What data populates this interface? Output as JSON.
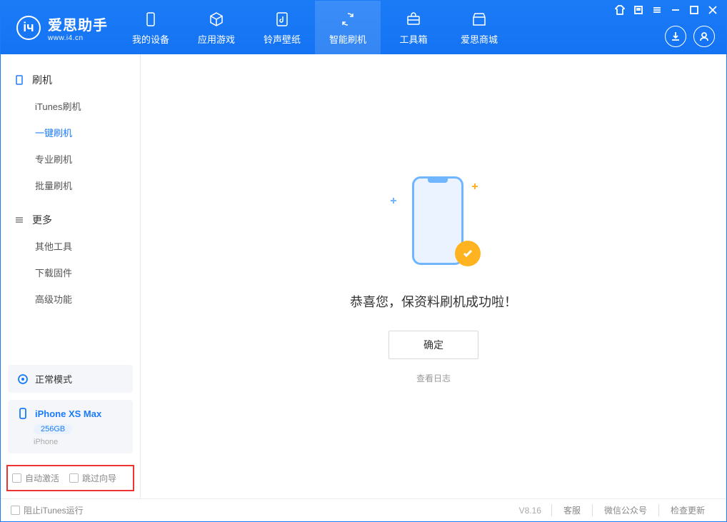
{
  "app": {
    "title": "爱思助手",
    "subtitle": "www.i4.cn"
  },
  "nav": {
    "tabs": [
      {
        "label": "我的设备"
      },
      {
        "label": "应用游戏"
      },
      {
        "label": "铃声壁纸"
      },
      {
        "label": "智能刷机"
      },
      {
        "label": "工具箱"
      },
      {
        "label": "爱思商城"
      }
    ]
  },
  "sidebar": {
    "sections": [
      {
        "title": "刷机",
        "items": [
          "iTunes刷机",
          "一键刷机",
          "专业刷机",
          "批量刷机"
        ]
      },
      {
        "title": "更多",
        "items": [
          "其他工具",
          "下载固件",
          "高级功能"
        ]
      }
    ],
    "mode_label": "正常模式",
    "device": {
      "name": "iPhone XS Max",
      "storage": "256GB",
      "type": "iPhone"
    },
    "checkboxes": {
      "auto_activate": "自动激活",
      "skip_guide": "跳过向导"
    }
  },
  "main": {
    "success_text": "恭喜您，保资料刷机成功啦！",
    "ok_button": "确定",
    "view_log": "查看日志"
  },
  "footer": {
    "block_itunes": "阻止iTunes运行",
    "version": "V8.16",
    "links": [
      "客服",
      "微信公众号",
      "检查更新"
    ]
  }
}
